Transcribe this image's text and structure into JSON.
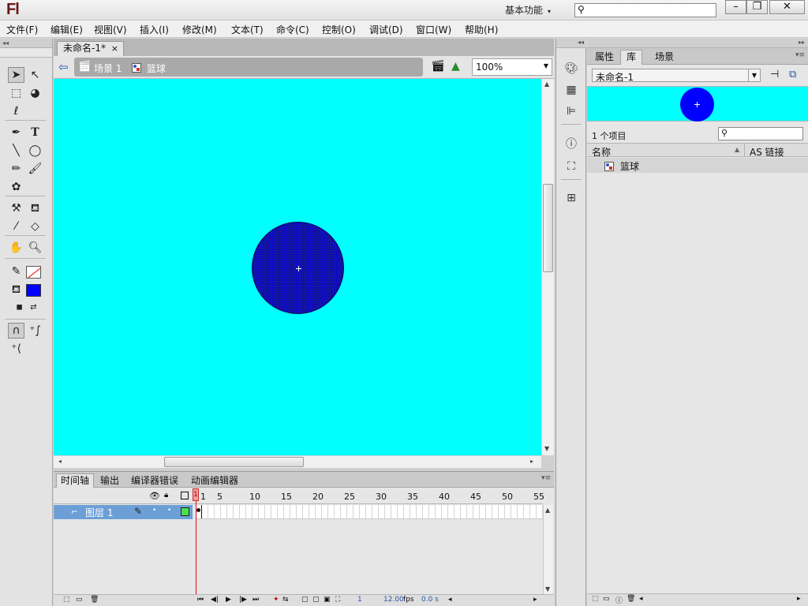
{
  "app": {
    "logo": "Fl",
    "workspace": "基本功能"
  },
  "window": {
    "minimize": "–",
    "maximize": "❐",
    "close": "✕"
  },
  "menu": [
    "文件(F)",
    "编辑(E)",
    "视图(V)",
    "插入(I)",
    "修改(M)",
    "文本(T)",
    "命令(C)",
    "控制(O)",
    "调试(D)",
    "窗口(W)",
    "帮助(H)"
  ],
  "document": {
    "tab_title": "未命名-1*",
    "tab_close": "×",
    "scene": "场景 1",
    "symbol": "篮球",
    "zoom": "100%"
  },
  "stage": {
    "background": "#00ffff",
    "ball_color": "#0000cc"
  },
  "timeline": {
    "tabs": [
      "时间轴",
      "输出",
      "编译器错误",
      "动画编辑器"
    ],
    "layer_name": "图层 1",
    "frame_numbers": [
      "1",
      "5",
      "10",
      "15",
      "20",
      "25",
      "30",
      "35",
      "40",
      "45",
      "50",
      "55"
    ],
    "current_frame": "1",
    "fps": "12.00",
    "fps_unit": "fps",
    "time": "0.0 s"
  },
  "library": {
    "tabs": [
      "属性",
      "库",
      "场景"
    ],
    "document": "未命名-1",
    "item_count": "1 个项目",
    "col_name": "名称",
    "col_link": "AS 链接",
    "items": [
      {
        "name": "篮球",
        "icon": "movieclip-icon"
      }
    ]
  }
}
